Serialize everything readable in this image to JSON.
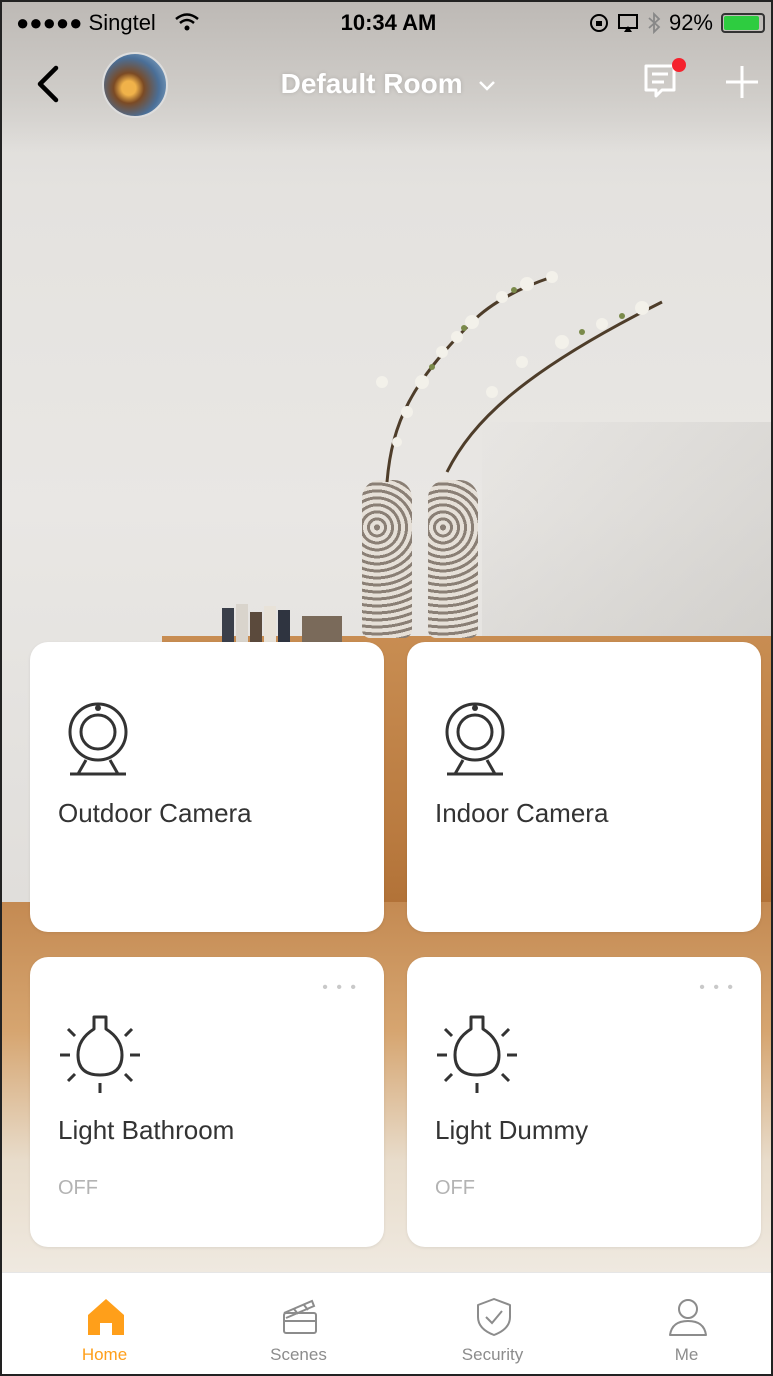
{
  "status_bar": {
    "carrier": "●●●●● Singtel",
    "time": "10:34 AM",
    "battery": "92%",
    "battery_level": 0.92
  },
  "nav": {
    "room_title": "Default Room",
    "back_icon": "chevron-left-icon",
    "message_icon": "message-icon",
    "add_icon": "plus-icon"
  },
  "devices": [
    {
      "name": "Outdoor Camera",
      "type": "camera",
      "icon": "camera-icon"
    },
    {
      "name": "Indoor Camera",
      "type": "camera",
      "icon": "camera-icon"
    },
    {
      "name": "Light Bathroom",
      "type": "light",
      "icon": "bulb-icon",
      "state": "OFF"
    },
    {
      "name": "Light Dummy",
      "type": "light",
      "icon": "bulb-icon",
      "state": "OFF"
    }
  ],
  "tabs": [
    {
      "label": "Home",
      "icon": "home-icon",
      "active": true
    },
    {
      "label": "Scenes",
      "icon": "clapperboard-icon",
      "active": false
    },
    {
      "label": "Security",
      "icon": "shield-check-icon",
      "active": false
    },
    {
      "label": "Me",
      "icon": "person-icon",
      "active": false
    }
  ],
  "colors": {
    "accent": "#ff9f1a",
    "notification_dot": "#f5222d",
    "battery_fill": "#2ecc40"
  }
}
